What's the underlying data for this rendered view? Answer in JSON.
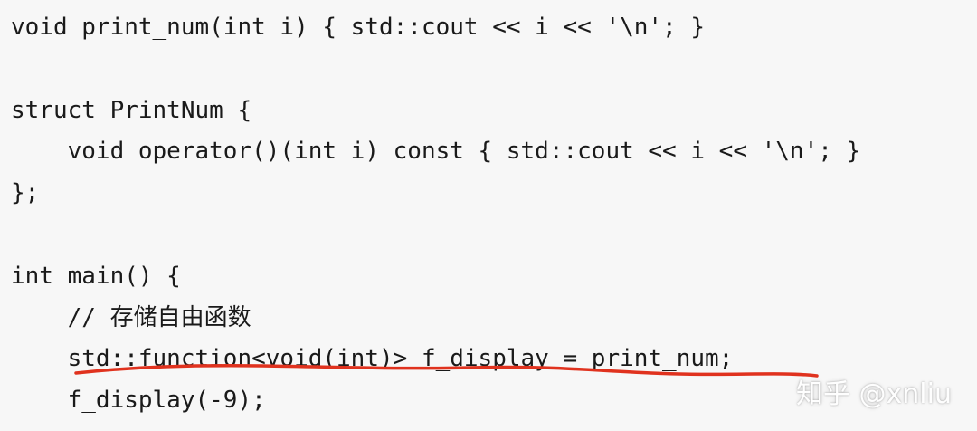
{
  "code": {
    "lines": [
      "void print_num(int i) { std::cout << i << '\\n'; }",
      "",
      "struct PrintNum {",
      "    void operator()(int i) const { std::cout << i << '\\n'; }",
      "};",
      "",
      "int main() {",
      "    // 存储自由函数",
      "    std::function<void(int)> f_display = print_num;",
      "    f_display(-9);"
    ]
  },
  "annotation": {
    "underline_color": "#e0321e"
  },
  "watermark": {
    "text": "知乎 @xnliu"
  }
}
